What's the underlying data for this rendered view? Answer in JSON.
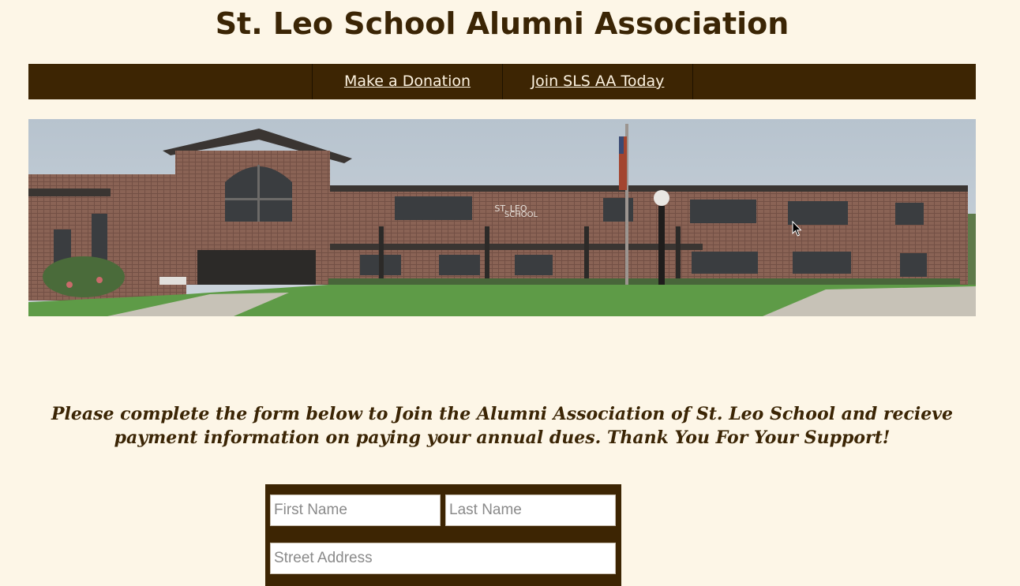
{
  "header": {
    "title": "St. Leo School Alumni Association"
  },
  "nav": {
    "donate_label": "Make a Donation",
    "join_label": "Join SLS AA Today"
  },
  "hero": {
    "sign_line1": "ST. LEO",
    "sign_line2": "SCHOOL"
  },
  "intro": {
    "text": "Please complete the form below to Join the Alumni Association of St. Leo School and recieve payment information on paying your annual dues. Thank You For Your Support!"
  },
  "form": {
    "first_name_placeholder": "First Name",
    "last_name_placeholder": "Last Name",
    "street_placeholder": "Street Address"
  },
  "colors": {
    "background": "#fdf6e7",
    "brand_brown": "#3d2503",
    "text_brown": "#3b2505"
  }
}
